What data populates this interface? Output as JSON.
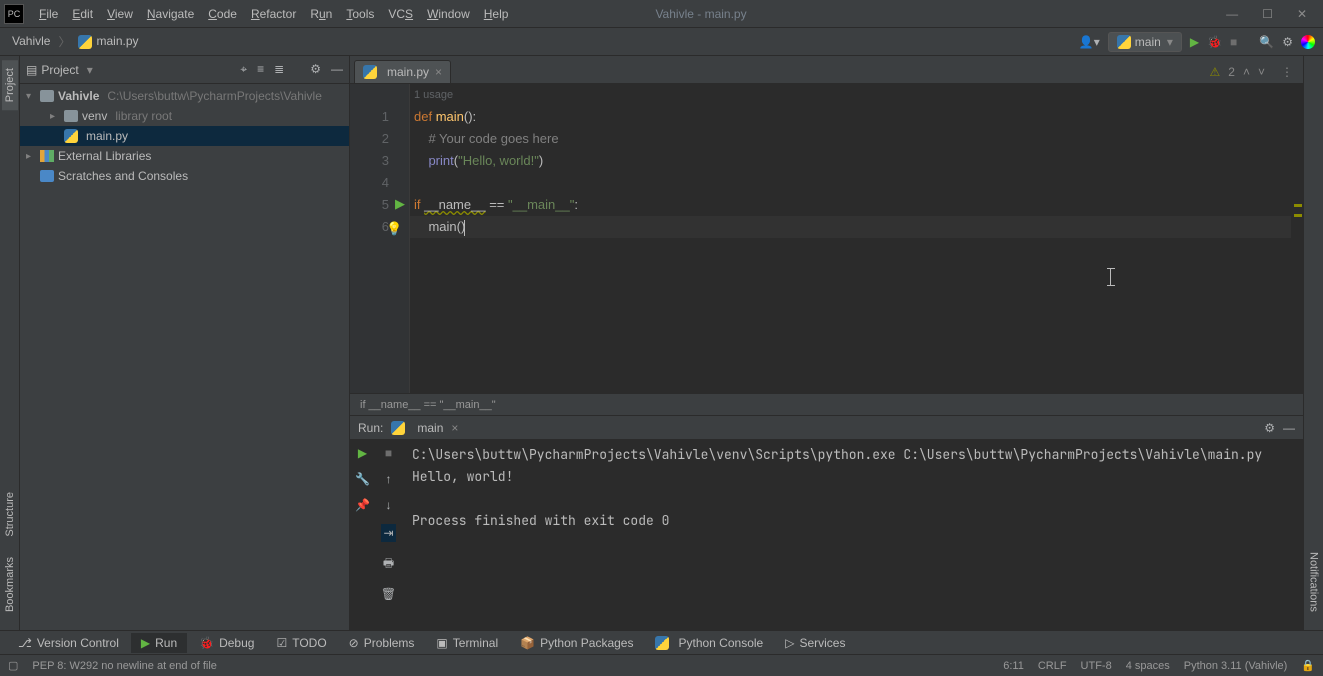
{
  "window": {
    "title": "Vahivle - main.py"
  },
  "menu": [
    "File",
    "Edit",
    "View",
    "Navigate",
    "Code",
    "Refactor",
    "Run",
    "Tools",
    "VCS",
    "Window",
    "Help"
  ],
  "breadcrumb": {
    "project": "Vahivle",
    "file": "main.py"
  },
  "runConfig": {
    "name": "main"
  },
  "projectPanel": {
    "title": "Project",
    "root": {
      "name": "Vahivle",
      "path": "C:\\Users\\buttw\\PycharmProjects\\Vahivle"
    },
    "venv": {
      "name": "venv",
      "hint": "library root"
    },
    "file": "main.py",
    "external": "External Libraries",
    "scratches": "Scratches and Consoles"
  },
  "editor": {
    "tab": "main.py",
    "usageHint": "1 usage",
    "inspections": "2",
    "lines": [
      "1",
      "2",
      "3",
      "4",
      "5",
      "6"
    ],
    "code": {
      "l1_def": "def ",
      "l1_fn": "main",
      "l1_rest": "():",
      "l2": "    # Your code goes here",
      "l3_print": "print",
      "l3_open": "(",
      "l3_str": "\"Hello, world!\"",
      "l3_close": ")",
      "l5_if": "if ",
      "l5_name": "__name__",
      "l5_eq": " == ",
      "l5_str": "\"__main__\"",
      "l5_colon": ":",
      "l6_indent": "    ",
      "l6_fn": "main",
      "l6_paren": "()"
    },
    "breadcrumb": "if __name__ == \"__main__\""
  },
  "run": {
    "label": "Run:",
    "config": "main",
    "output": "C:\\Users\\buttw\\PycharmProjects\\Vahivle\\venv\\Scripts\\python.exe C:\\Users\\buttw\\PycharmProjects\\Vahivle\\main.py\nHello, world!\n\nProcess finished with exit code 0"
  },
  "bottomTools": {
    "vcs": "Version Control",
    "run": "Run",
    "debug": "Debug",
    "todo": "TODO",
    "problems": "Problems",
    "terminal": "Terminal",
    "pypkg": "Python Packages",
    "pyconsole": "Python Console",
    "services": "Services"
  },
  "status": {
    "hint": "PEP 8: W292 no newline at end of file",
    "pos": "6:11",
    "eol": "CRLF",
    "enc": "UTF-8",
    "indent": "4 spaces",
    "interpreter": "Python 3.11 (Vahivle)"
  },
  "sideTabs": {
    "project": "Project",
    "structure": "Structure",
    "bookmarks": "Bookmarks",
    "notifications": "Notifications"
  }
}
